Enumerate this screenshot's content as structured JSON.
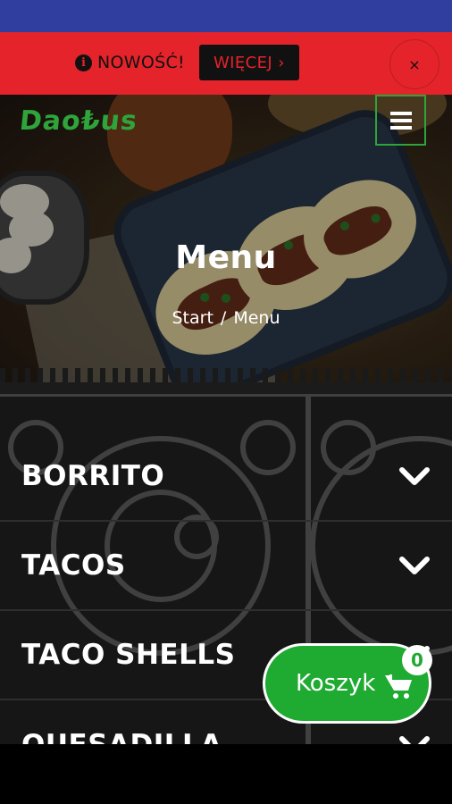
{
  "promo": {
    "info_icon": "info-icon",
    "text": "NOWOŚĆ!",
    "more_label": "WIĘCEJ ›",
    "close_label": "×"
  },
  "header": {
    "logo_text": "Dao₺us",
    "menu_icon": "hamburger-icon"
  },
  "hero": {
    "title": "Menu",
    "breadcrumb": {
      "home": "Start",
      "separator": "/",
      "current": "Menu"
    }
  },
  "categories": [
    {
      "label": "BORRITO",
      "icon": "chevron-down-icon"
    },
    {
      "label": "TACOS",
      "icon": "chevron-down-icon"
    },
    {
      "label": "TACO SHELLS",
      "icon": "chevron-down-icon"
    },
    {
      "label": "QUESADILLA",
      "icon": "chevron-down-icon"
    }
  ],
  "cart": {
    "label": "Koszyk",
    "icon": "cart-icon",
    "count": "0"
  },
  "colors": {
    "status_bar": "#2f3e9f",
    "promo_red": "#e5232a",
    "brand_green": "#2ea43a",
    "cart_green": "#1faa32"
  }
}
